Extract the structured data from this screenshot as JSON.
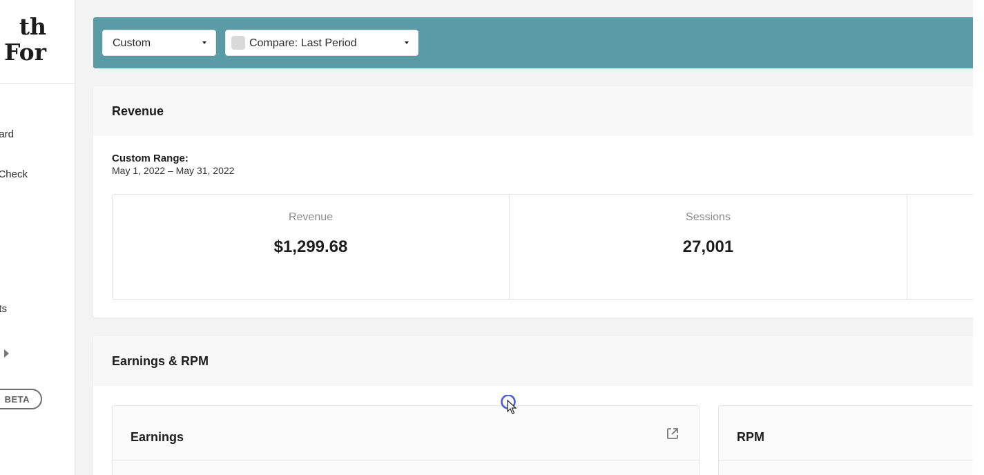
{
  "sidebar": {
    "brand_line1": "th",
    "brand_line2": "g For",
    "items": [
      {
        "label": "ard"
      },
      {
        "label": "Check"
      },
      {
        "label": "ts"
      }
    ],
    "beta_label": "BETA"
  },
  "filters": {
    "range_value": "Custom",
    "compare_value": "Compare: Last Period"
  },
  "revenue_card": {
    "title": "Revenue",
    "range_title": "Custom Range:",
    "range_dates": "May 1, 2022 – May 31, 2022",
    "metrics": [
      {
        "label": "Revenue",
        "value": "$1,299.68"
      },
      {
        "label": "Sessions",
        "value": "27,001"
      }
    ]
  },
  "earnings_card": {
    "title": "Earnings & RPM",
    "panels": [
      {
        "title": "Earnings",
        "icon": "external-link-icon"
      },
      {
        "title": "RPM"
      }
    ]
  },
  "colors": {
    "filter_bar": "#5b9ba6",
    "cursor_ring": "#4a5bd8"
  }
}
